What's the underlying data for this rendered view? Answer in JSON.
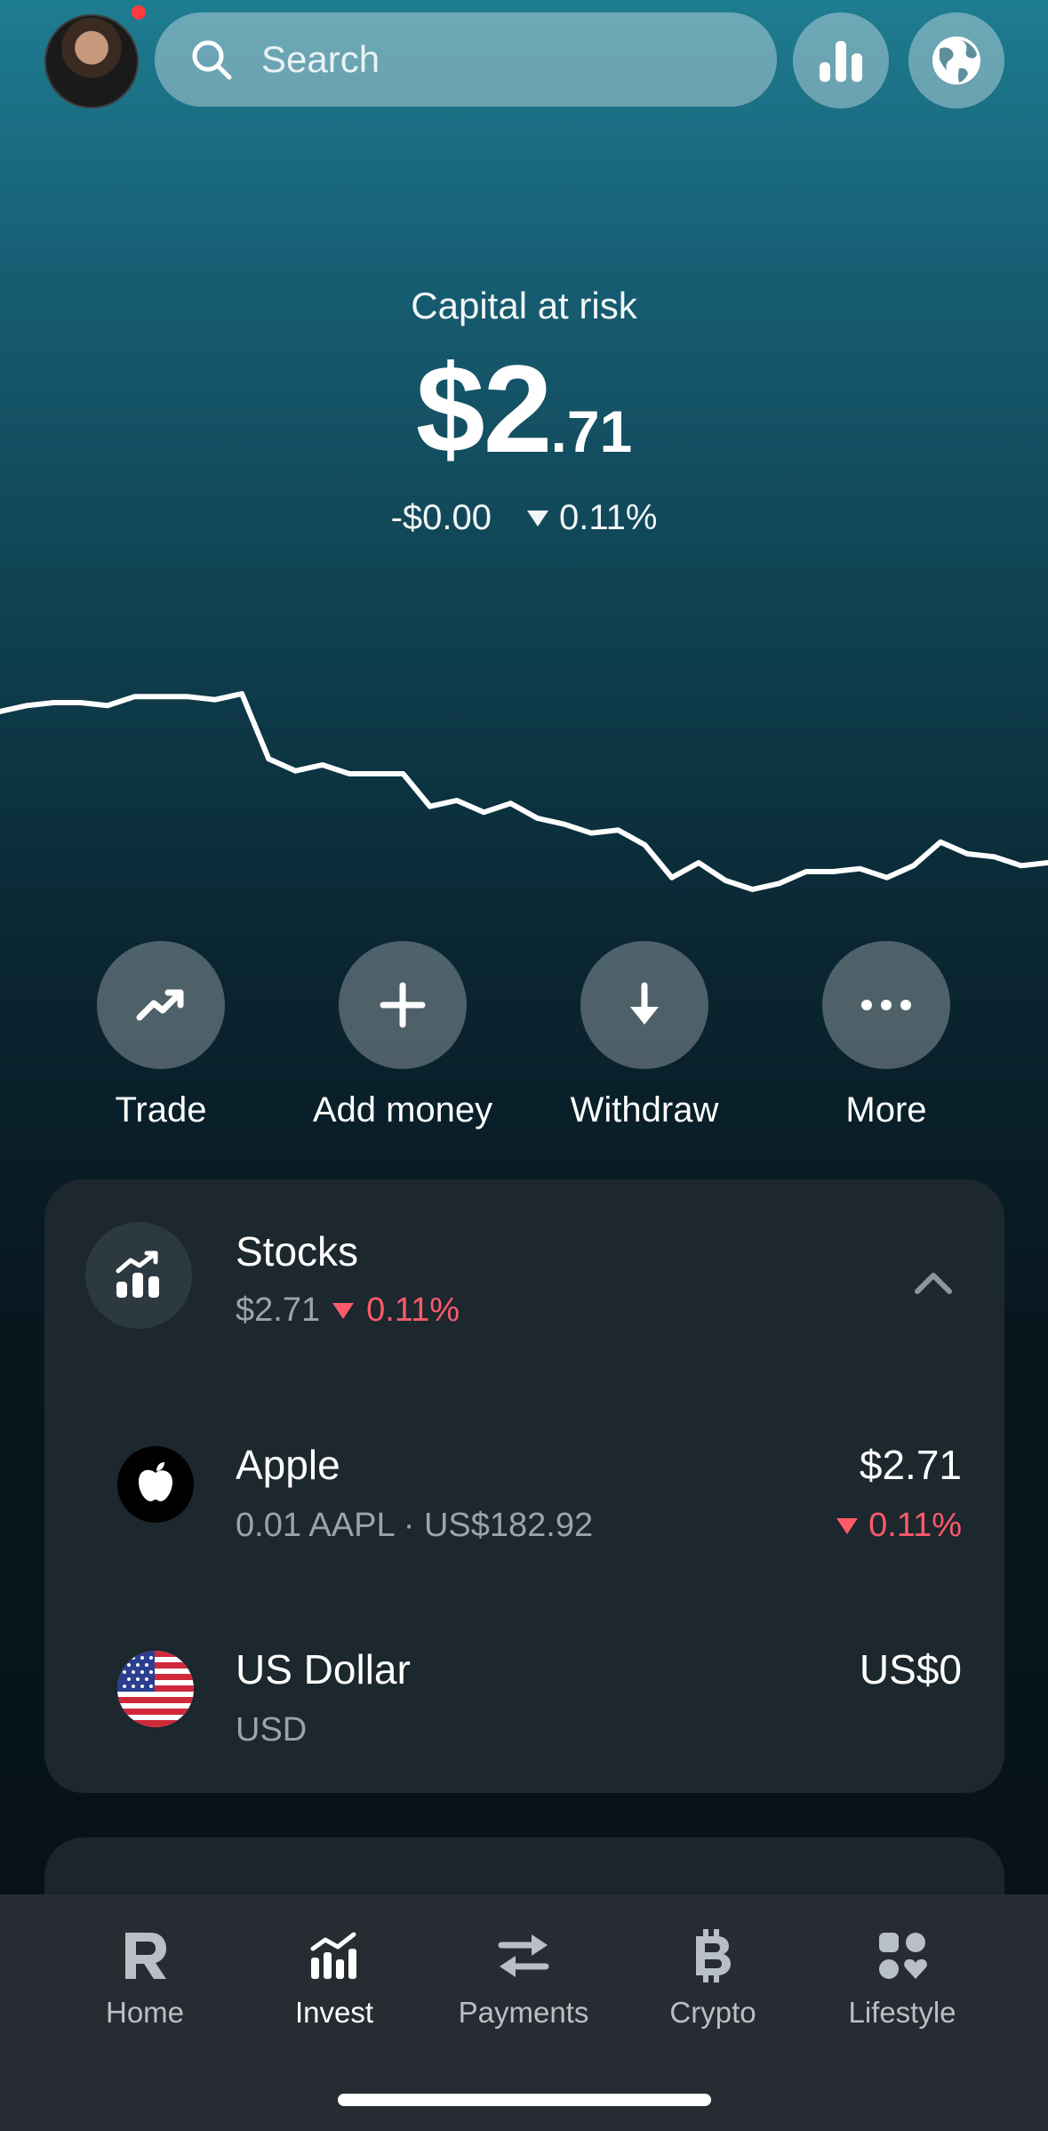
{
  "topbar": {
    "search_placeholder": "Search",
    "avatar_has_notification": true
  },
  "hero": {
    "label": "Capital at risk",
    "amount_whole": "$2",
    "amount_cents": ".71",
    "change_abs": "-$0.00",
    "change_pct": "0.11%"
  },
  "chart_data": {
    "type": "line",
    "x": [
      0,
      1,
      2,
      3,
      4,
      5,
      6,
      7,
      8,
      9,
      10,
      11,
      12,
      13,
      14,
      15,
      16,
      17,
      18,
      19,
      20,
      21,
      22,
      23,
      24,
      25,
      26,
      27,
      28,
      29,
      30,
      31,
      32,
      33,
      34,
      35,
      36,
      37,
      38,
      39
    ],
    "values": [
      100,
      100.2,
      100.3,
      100.3,
      100.2,
      100.5,
      100.5,
      100.5,
      100.4,
      100.6,
      98.4,
      98.0,
      98.2,
      97.9,
      97.9,
      97.9,
      96.8,
      97.0,
      96.6,
      96.9,
      96.4,
      96.2,
      95.9,
      96.0,
      95.5,
      94.4,
      94.9,
      94.3,
      94.0,
      94.2,
      94.6,
      94.6,
      94.7,
      94.4,
      94.8,
      95.6,
      95.2,
      95.1,
      94.8,
      94.9
    ],
    "grid": false
  },
  "actions": [
    {
      "label": "Trade",
      "icon": "trend-up-icon"
    },
    {
      "label": "Add money",
      "icon": "plus-icon"
    },
    {
      "label": "Withdraw",
      "icon": "arrow-down-icon"
    },
    {
      "label": "More",
      "icon": "more-dots-icon"
    }
  ],
  "stocks": {
    "title": "Stocks",
    "value": "$2.71",
    "change_pct": "0.11%",
    "items": [
      {
        "name": "Apple",
        "sub": "0.01 AAPL · US$182.92",
        "value": "$2.71",
        "change": "0.11%",
        "logo": "apple-logo-icon"
      },
      {
        "name": "US Dollar",
        "sub": "USD",
        "value": "US$0",
        "logo": "us-flag-icon"
      }
    ]
  },
  "tabs": [
    {
      "label": "Home",
      "icon": "revolut-r-icon",
      "active": false
    },
    {
      "label": "Invest",
      "icon": "invest-chart-icon",
      "active": true
    },
    {
      "label": "Payments",
      "icon": "transfer-arrows-icon",
      "active": false
    },
    {
      "label": "Crypto",
      "icon": "bitcoin-icon",
      "active": false
    },
    {
      "label": "Lifestyle",
      "icon": "lifestyle-grid-icon",
      "active": false
    }
  ],
  "colors": {
    "accent_red": "#ff5a6a",
    "card_bg": "#1c272e",
    "tabbar_bg": "#262c31"
  }
}
